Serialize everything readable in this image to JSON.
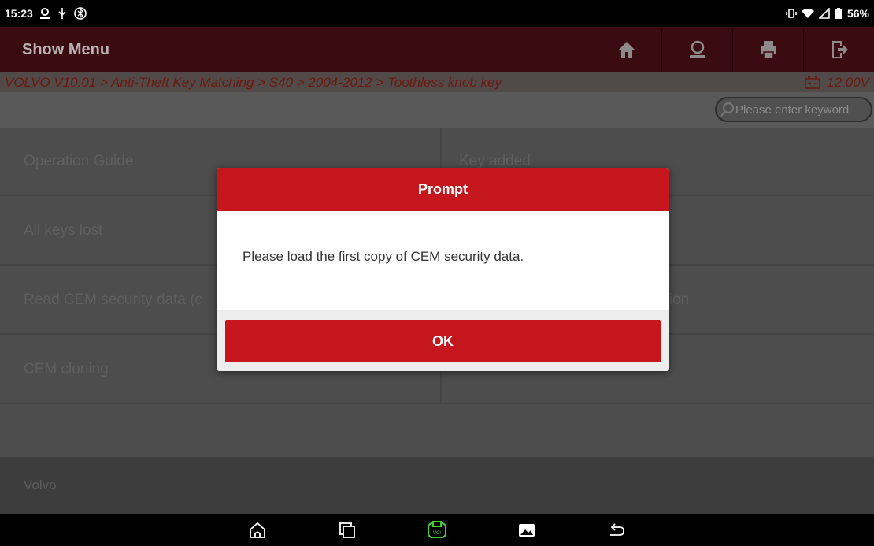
{
  "status_bar": {
    "time": "15:23",
    "battery": "56%"
  },
  "header": {
    "title": "Show Menu",
    "buttons": [
      {
        "name": "home",
        "icon": "home-icon"
      },
      {
        "name": "user",
        "icon": "user-icon"
      },
      {
        "name": "print",
        "icon": "printer-icon"
      },
      {
        "name": "exit",
        "icon": "exit-icon"
      }
    ]
  },
  "breadcrumb": {
    "path": "VOLVO V10.01 > Anti-Theft Key Matching > S40 > 2004-2012 > Toothless knob key",
    "voltage": "12.00V"
  },
  "search": {
    "placeholder": "Please enter keyword"
  },
  "menu": {
    "items": [
      {
        "label": "Operation Guide",
        "column": "left"
      },
      {
        "label": "Key added",
        "column": "right"
      },
      {
        "label": "All keys lost",
        "column": "left"
      },
      {
        "label": "",
        "column": "right"
      },
      {
        "label": "Read CEM security data (c",
        "column": "left"
      },
      {
        "label": "ion",
        "column": "right"
      },
      {
        "label": "CEM cloning",
        "column": "left"
      },
      {
        "label": "",
        "column": "right"
      }
    ]
  },
  "footer": {
    "brand": "Volvo"
  },
  "dialog": {
    "title": "Prompt",
    "message": "Please load the first copy of CEM security data.",
    "ok_label": "OK"
  },
  "colors": {
    "accent": "#c4161c",
    "vci_green": "#3ecf2e"
  }
}
